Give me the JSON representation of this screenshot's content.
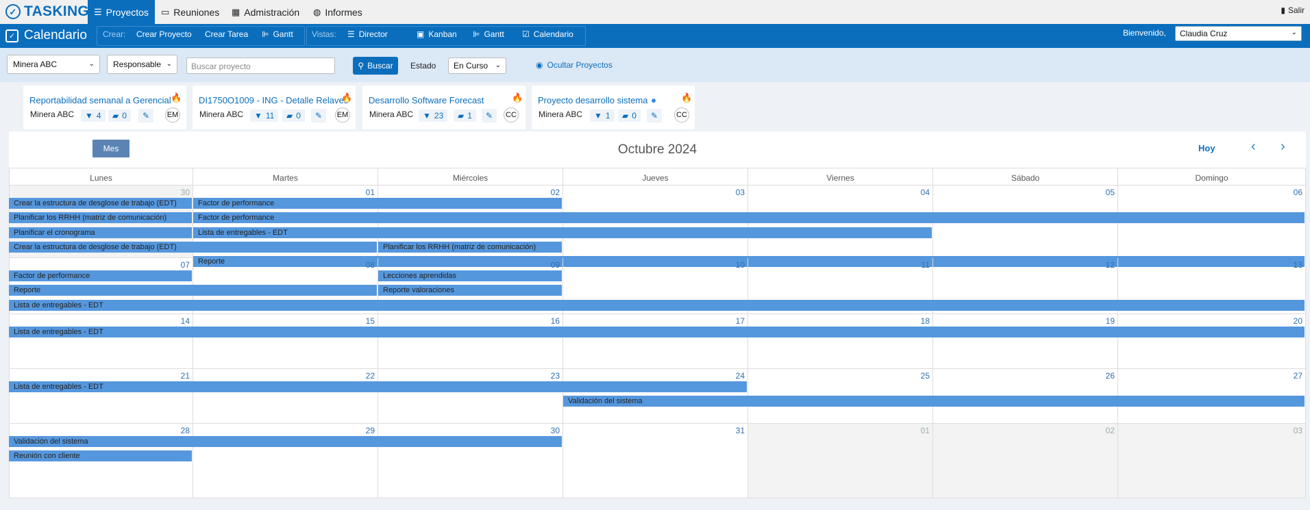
{
  "brand": {
    "name": "TASKING",
    "icon": "check-circle-icon"
  },
  "nav": {
    "tabs": [
      {
        "label": "Proyectos",
        "icon": "list-icon",
        "active": true
      },
      {
        "label": "Reuniones",
        "icon": "calendar-19-icon",
        "active": false
      },
      {
        "label": "Admistración",
        "icon": "table-icon",
        "active": false
      },
      {
        "label": "Informes",
        "icon": "palette-icon",
        "active": false
      }
    ],
    "logout_label": "Salir"
  },
  "toolbar": {
    "page_title": "Calendario",
    "crear_label": "Crear:",
    "crear_proyecto": "Crear Proyecto",
    "crear_tarea": "Crear Tarea",
    "gantt": "Gantt",
    "vistas_label": "Vistas:",
    "director": "Director",
    "kanban": "Kanban",
    "gantt_vista": "Gantt",
    "calendario": "Calendario",
    "welcome": "Bienvenido,",
    "user": "Claudia Cruz"
  },
  "filters": {
    "company": "Minera ABC",
    "responsable": "Responsable",
    "search_placeholder": "Buscar proyecto",
    "search_button": "Buscar",
    "estado_label": "Estado",
    "estado_value": "En Curso",
    "hide_projects": "Ocultar Proyectos"
  },
  "projects": [
    {
      "title": "Reportabilidad semanal a Gerencial",
      "company": "Minera ABC",
      "tasks": "4",
      "comments": "0",
      "initials": "EM"
    },
    {
      "title": "DI1750O1009 - ING - Detalle Relaves",
      "company": "Minera ABC",
      "tasks": "11",
      "comments": "0",
      "initials": "EM"
    },
    {
      "title": "Desarrollo Software Forecast",
      "company": "Minera ABC",
      "tasks": "23",
      "comments": "1",
      "initials": "CC"
    },
    {
      "title": "Proyecto desarrollo sistema",
      "company": "Minera ABC",
      "tasks": "1",
      "comments": "0",
      "initials": "CC"
    }
  ],
  "calendar": {
    "view_button": "Mes",
    "month_title": "Octubre 2024",
    "today_button": "Hoy",
    "weekdays": [
      "Lunes",
      "Martes",
      "Miércoles",
      "Jueves",
      "Viernes",
      "Sábado",
      "Domingo"
    ],
    "weeks": [
      {
        "days": [
          "30",
          "01",
          "02",
          "03",
          "04",
          "05",
          "06"
        ],
        "other": [
          true,
          false,
          false,
          false,
          false,
          false,
          false
        ],
        "events": [
          {
            "label": "Crear la estructura de desglose de trabajo (EDT)",
            "start": 0,
            "span": 1,
            "row": 0
          },
          {
            "label": "Factor de performance",
            "start": 1,
            "span": 2,
            "row": 0
          },
          {
            "label": "Planificar los RRHH (matriz de comunicación)",
            "start": 0,
            "span": 1,
            "row": 1
          },
          {
            "label": "Factor de performance",
            "start": 1,
            "span": 6,
            "row": 1
          },
          {
            "label": "Planificar el cronograma",
            "start": 0,
            "span": 1,
            "row": 2
          },
          {
            "label": "Lista de entregables - EDT",
            "start": 1,
            "span": 4,
            "row": 2
          },
          {
            "label": "Crear la estructura de desglose de trabajo (EDT)",
            "start": 0,
            "span": 2,
            "row": 3
          },
          {
            "label": "Planificar los RRHH (matriz de comunicación)",
            "start": 2,
            "span": 1,
            "row": 3
          },
          {
            "label": "Reporte",
            "start": 1,
            "span": 6,
            "row": 4
          }
        ]
      },
      {
        "days": [
          "07",
          "08",
          "09",
          "10",
          "11",
          "12",
          "13"
        ],
        "other": [
          false,
          false,
          false,
          false,
          false,
          false,
          false
        ],
        "events": [
          {
            "label": "Factor de performance",
            "start": 0,
            "span": 1,
            "row": 0
          },
          {
            "label": "Lecciones aprendidas",
            "start": 2,
            "span": 1,
            "row": 0
          },
          {
            "label": "Reporte",
            "start": 0,
            "span": 2,
            "row": 1
          },
          {
            "label": "Reporte valoraciones",
            "start": 2,
            "span": 1,
            "row": 1
          },
          {
            "label": "Lista de entregables - EDT",
            "start": 0,
            "span": 7,
            "row": 2
          }
        ]
      },
      {
        "days": [
          "14",
          "15",
          "16",
          "17",
          "18",
          "19",
          "20"
        ],
        "other": [
          false,
          false,
          false,
          false,
          false,
          false,
          false
        ],
        "events": [
          {
            "label": "Lista de entregables - EDT",
            "start": 0,
            "span": 7,
            "row": 0
          }
        ]
      },
      {
        "days": [
          "21",
          "22",
          "23",
          "24",
          "25",
          "26",
          "27"
        ],
        "other": [
          false,
          false,
          false,
          false,
          false,
          false,
          false
        ],
        "events": [
          {
            "label": "Lista de entregables - EDT",
            "start": 0,
            "span": 4,
            "row": 0
          },
          {
            "label": "Validación del sistema",
            "start": 3,
            "span": 4,
            "row": 1
          }
        ]
      },
      {
        "days": [
          "28",
          "29",
          "30",
          "31",
          "01",
          "02",
          "03"
        ],
        "other": [
          false,
          false,
          false,
          false,
          true,
          true,
          true
        ],
        "events": [
          {
            "label": "Validación del sistema",
            "start": 0,
            "span": 3,
            "row": 0
          },
          {
            "label": "Reunión con cliente",
            "start": 0,
            "span": 1,
            "row": 1
          }
        ]
      }
    ]
  }
}
